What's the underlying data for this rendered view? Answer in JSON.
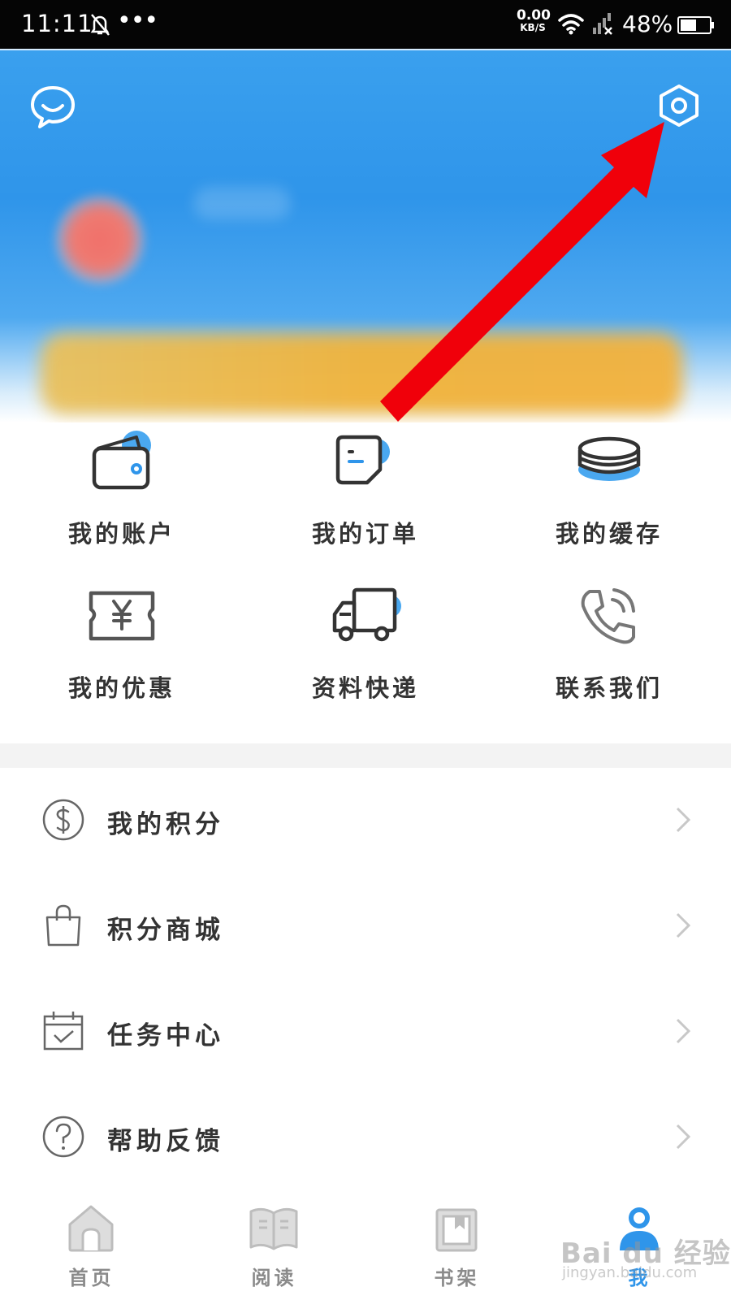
{
  "status_bar": {
    "time": "11:11",
    "dots": "•••",
    "net_speed_value": "0.00",
    "net_speed_unit": "KB/S",
    "battery_percent": "48%"
  },
  "header": {
    "icons": {
      "chat": "chat-bubble-icon",
      "settings": "hexagon-settings-icon"
    },
    "colors": {
      "accent": "#2f95ea",
      "vip_band": "#f1b33a",
      "avatar": "#ef7b72",
      "arrow": "#f0000a"
    }
  },
  "grid": {
    "items": [
      {
        "label": "我的账户",
        "icon": "wallet-icon"
      },
      {
        "label": "我的订单",
        "icon": "order-doc-icon"
      },
      {
        "label": "我的缓存",
        "icon": "cache-stack-icon"
      },
      {
        "label": "我的优惠",
        "icon": "coupon-yen-icon"
      },
      {
        "label": "资料快递",
        "icon": "delivery-truck-icon"
      },
      {
        "label": "联系我们",
        "icon": "phone-icon"
      }
    ]
  },
  "list": {
    "items": [
      {
        "label": "我的积分",
        "icon": "dollar-circle-icon"
      },
      {
        "label": "积分商城",
        "icon": "shopping-bag-icon"
      },
      {
        "label": "任务中心",
        "icon": "calendar-check-icon"
      },
      {
        "label": "帮助反馈",
        "icon": "question-circle-icon"
      }
    ]
  },
  "bottom_nav": {
    "items": [
      {
        "label": "首页",
        "icon": "home-icon"
      },
      {
        "label": "阅读",
        "icon": "open-book-icon"
      },
      {
        "label": "书架",
        "icon": "bookshelf-icon"
      },
      {
        "label": "我",
        "icon": "profile-icon",
        "active": true
      }
    ]
  },
  "watermark": {
    "text": "Bai du 经验",
    "sub": "jingyan.baidu.com"
  }
}
